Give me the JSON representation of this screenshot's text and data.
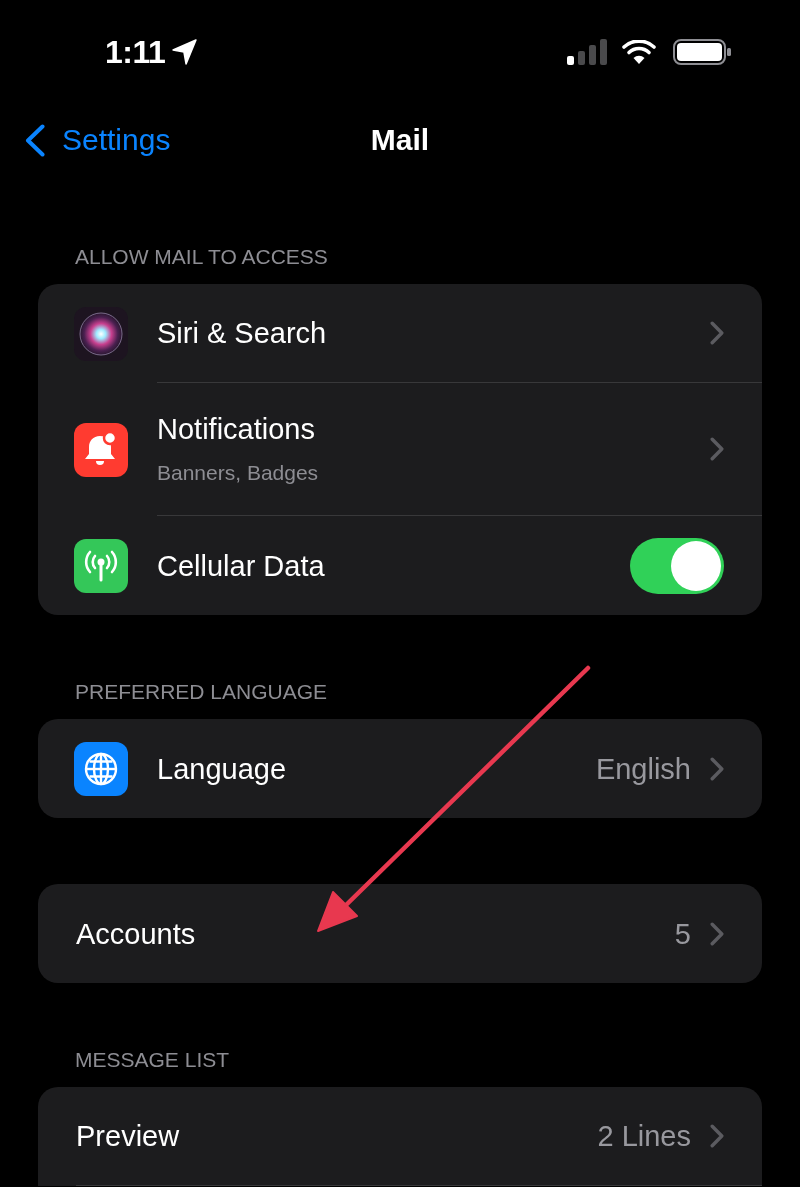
{
  "status_bar": {
    "time": "1:11"
  },
  "nav_bar": {
    "back_label": "Settings",
    "title": "Mail"
  },
  "sections": [
    {
      "header": "ALLOW MAIL TO ACCESS",
      "rows": [
        {
          "kind": "link",
          "label": "Siri & Search"
        },
        {
          "kind": "link",
          "label": "Notifications",
          "subtitle": "Banners, Badges"
        },
        {
          "kind": "toggle",
          "label": "Cellular Data",
          "on": true
        }
      ]
    },
    {
      "header": "PREFERRED LANGUAGE",
      "rows": [
        {
          "kind": "link",
          "label": "Language",
          "value": "English"
        }
      ]
    },
    {
      "rows": [
        {
          "kind": "link",
          "label": "Accounts",
          "value": "5"
        }
      ]
    },
    {
      "header": "MESSAGE LIST",
      "rows": [
        {
          "kind": "link",
          "label": "Preview",
          "value": "2 Lines"
        }
      ]
    }
  ]
}
